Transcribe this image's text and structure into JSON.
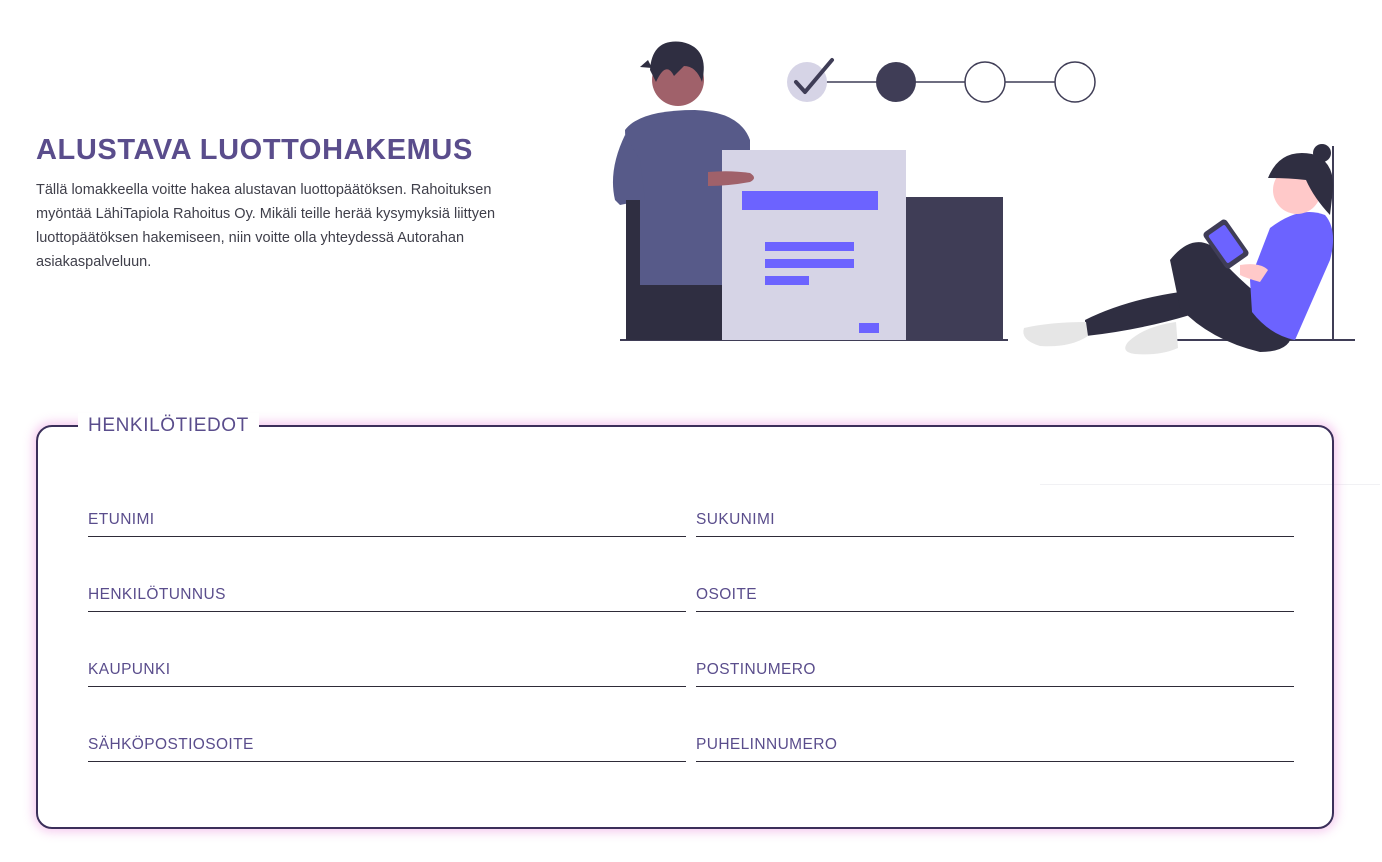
{
  "intro": {
    "title": "ALUSTAVA LUOTTOHAKEMUS",
    "description": "Tällä lomakkeella voitte hakea alustavan luottopäätöksen. Rahoituksen myöntää LähiTapiola Rahoitus Oy. Mikäli teille herää kysymyksiä liittyen luottopäätöksen hakemiseen, niin voitte olla yhteydessä Autorahan asiakaspalveluun."
  },
  "progress": {
    "steps_total": 4,
    "completed_steps": 1,
    "current_step": 2
  },
  "colors": {
    "accent_purple": "#5a4d8c",
    "illustration_violet": "#6c63ff",
    "dark_navy": "#3f3d56",
    "border": "#3b2f5a",
    "glow_pink": "#e98cdc"
  },
  "form": {
    "legend": "HENKILÖTIEDOT",
    "fields": [
      {
        "label": "ETUNIMI",
        "value": ""
      },
      {
        "label": "SUKUNIMI",
        "value": ""
      },
      {
        "label": "HENKILÖTUNNUS",
        "value": ""
      },
      {
        "label": "OSOITE",
        "value": ""
      },
      {
        "label": "KAUPUNKI",
        "value": ""
      },
      {
        "label": "POSTINUMERO",
        "value": ""
      },
      {
        "label": "SÄHKÖPOSTIOSOITE",
        "value": ""
      },
      {
        "label": "PUHELINNUMERO",
        "value": ""
      }
    ]
  }
}
